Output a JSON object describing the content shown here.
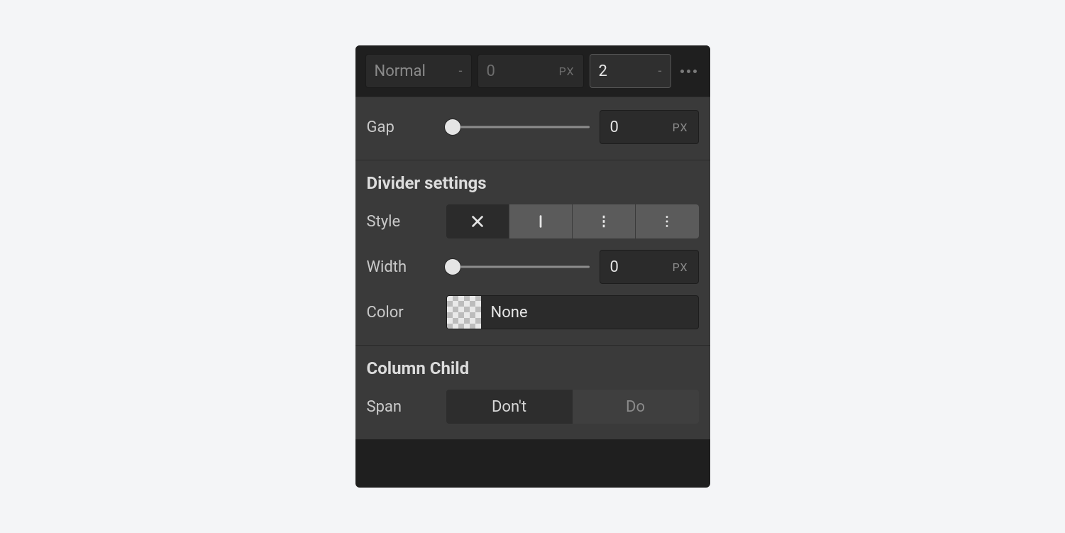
{
  "topbar": {
    "mode_label": "Normal",
    "mode_unit": "-",
    "field2_value": "0",
    "field2_unit": "PX",
    "field3_value": "2",
    "field3_unit": "-"
  },
  "gap": {
    "label": "Gap",
    "value": "0",
    "unit": "PX"
  },
  "divider": {
    "heading": "Divider settings",
    "style_label": "Style",
    "style_options": [
      "none",
      "solid",
      "dashed",
      "dotted"
    ],
    "style_selected_index": 0,
    "width_label": "Width",
    "width_value": "0",
    "width_unit": "PX",
    "color_label": "Color",
    "color_value": "None"
  },
  "column_child": {
    "heading": "Column Child",
    "span_label": "Span",
    "span_options": [
      "Don't",
      "Do"
    ],
    "span_selected_index": 0
  }
}
